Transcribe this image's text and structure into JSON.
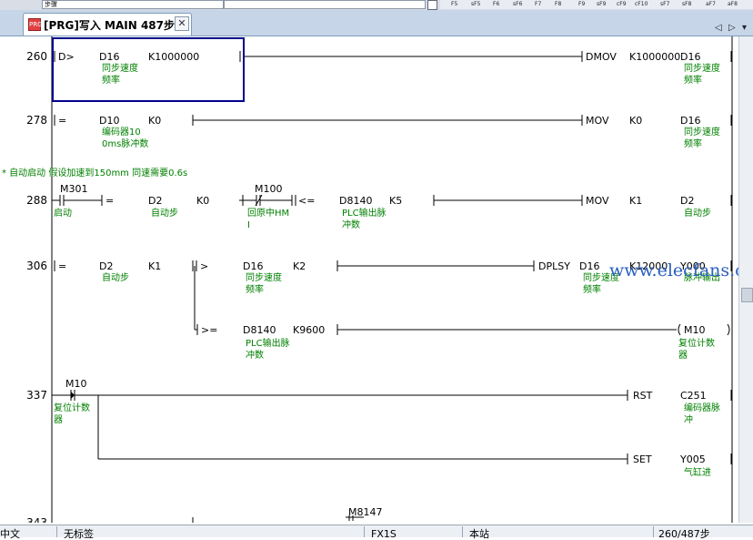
{
  "toolbar": {
    "combo_text": "步骤",
    "fkeys": [
      "F5",
      "sF5",
      "F6",
      "sF6",
      "F7",
      "F8",
      "F9",
      "sF9",
      "cF9",
      "cF10",
      "sF7",
      "sF8",
      "aF7",
      "aF8"
    ]
  },
  "tab": {
    "icon_text": "PRG",
    "title": "[PRG]写入 MAIN 487步",
    "close": "✕"
  },
  "nav": {
    "prev": "◁",
    "next": "▷",
    "down": "▾"
  },
  "comment_line": "* 自动启动 假设加速到150mm 同速需要0.6s",
  "watermark": "www.elecfans.com",
  "rungs": [
    {
      "step": "260",
      "cond": {
        "op": "D>",
        "a1": "D16",
        "a1_c1": "同步速度",
        "a1_c2": "频率",
        "a2": "K1000000"
      },
      "out": {
        "instr": "DMOV",
        "s": "K1000000",
        "d": "D16",
        "d_c1": "同步速度",
        "d_c2": "频率"
      }
    },
    {
      "step": "278",
      "cond": {
        "op": "=",
        "a1": "D10",
        "a1_c1": "编码器10",
        "a1_c2": "0ms脉冲数",
        "a2": "K0"
      },
      "out": {
        "instr": "MOV",
        "s": "K0",
        "d": "D16",
        "d_c1": "同步速度",
        "d_c2": "频率"
      }
    },
    {
      "step": "288",
      "c1": {
        "dev": "M301",
        "c": "启动"
      },
      "cond": {
        "op": "=",
        "a1": "D2",
        "a1_c": "自动步",
        "a2": "K0"
      },
      "c2": {
        "dev": "M100",
        "c1": "回原中HM",
        "c2": "I"
      },
      "cond2": {
        "op": "<=",
        "a1": "D8140",
        "a1_c1": "PLC输出脉",
        "a1_c2": "冲数",
        "a2": "K5"
      },
      "out": {
        "instr": "MOV",
        "s": "K1",
        "d": "D2",
        "d_c": "自动步"
      }
    },
    {
      "step": "306",
      "cond": {
        "op": "=",
        "a1": "D2",
        "a1_c": "自动步",
        "a2": "K1"
      },
      "cond2": {
        "op": ">",
        "a1": "D16",
        "a1_c1": "同步速度",
        "a1_c2": "频率",
        "a2": "K2"
      },
      "out": {
        "instr": "DPLSY",
        "s": "D16",
        "s_c1": "同步速度",
        "s_c2": "频率",
        "k": "K12000",
        "d": "Y000",
        "d_c": "脉冲输出"
      },
      "cond3": {
        "op": ">=",
        "a1": "D8140",
        "a1_c1": "PLC输出脉",
        "a1_c2": "冲数",
        "a2": "K9600"
      },
      "coil": {
        "dev": "M10",
        "c1": "复位计数",
        "c2": "器"
      }
    },
    {
      "step": "337",
      "c1": {
        "dev": "M10",
        "c1": "复位计数",
        "c2": "器"
      },
      "out": {
        "instr": "RST",
        "d": "C251",
        "d_c1": "编码器脉",
        "d_c2": "冲"
      },
      "out2": {
        "instr": "SET",
        "d": "Y005",
        "d_c": "气缸进"
      }
    },
    {
      "step": "343",
      "partial": {
        "dev": "M8147"
      }
    }
  ],
  "status": {
    "lang": "中文",
    "mode": "无标签",
    "plc": "FX1S",
    "station": "本站",
    "steps": "260/487步"
  }
}
